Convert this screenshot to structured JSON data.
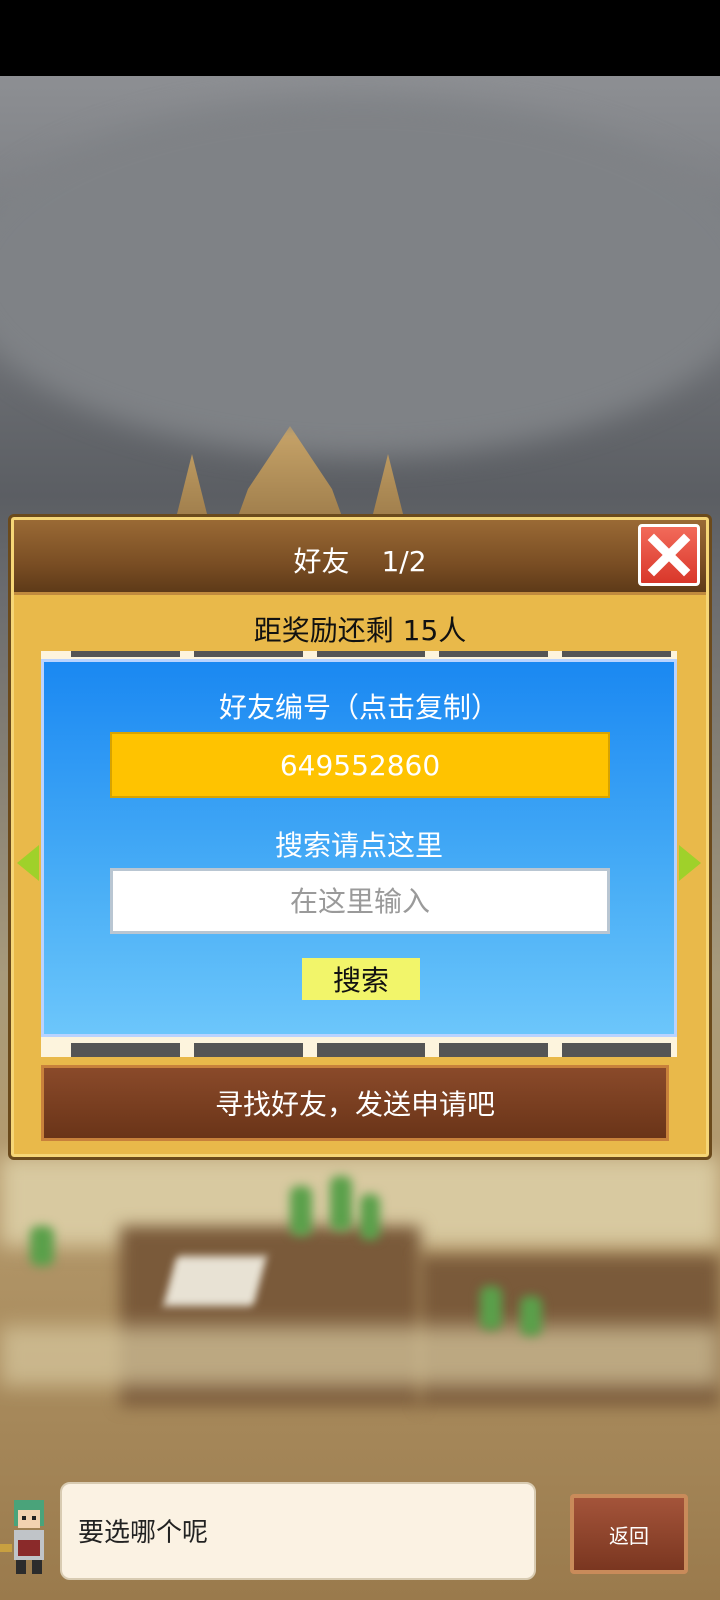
{
  "dialog": {
    "title": "好友",
    "page": "1/2",
    "close_icon": "close-icon",
    "reward_text": "距奖励还剩 15人"
  },
  "friend_card": {
    "id_label": "好友编号（点击复制）",
    "friend_id": "649552860",
    "search_label": "搜索请点这里",
    "search_placeholder": "在这里输入",
    "search_button": "搜索"
  },
  "find_button": "寻找好友，发送申请吧",
  "bottom": {
    "speech": "要选哪个呢",
    "back_button": "返回"
  },
  "colors": {
    "panel": "#e9b94a",
    "card_blue": "#1a88f2",
    "id_yellow": "#ffc300",
    "search_btn": "#f2f56a",
    "close_red": "#e0483a",
    "arrow_green": "#9fd12a"
  }
}
